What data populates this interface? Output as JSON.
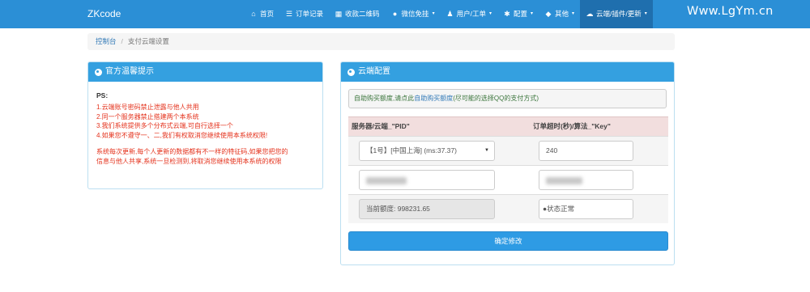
{
  "navbar": {
    "brand": "ZKcode",
    "items": [
      {
        "label": "首页",
        "icon": "home-icon",
        "glyph": "⌂",
        "caret": false,
        "active": false
      },
      {
        "label": "订单记录",
        "icon": "list-icon",
        "glyph": "☰",
        "caret": false,
        "active": false
      },
      {
        "label": "收款二维码",
        "icon": "qrcode-icon",
        "glyph": "▦",
        "caret": false,
        "active": false
      },
      {
        "label": "微信免挂",
        "icon": "wechat-icon",
        "glyph": "●",
        "caret": true,
        "active": false
      },
      {
        "label": "用户/工单",
        "icon": "user-icon",
        "glyph": "♟",
        "caret": true,
        "active": false
      },
      {
        "label": "配置",
        "icon": "gear-icon",
        "glyph": "✱",
        "caret": true,
        "active": false
      },
      {
        "label": "其他",
        "icon": "shield-icon",
        "glyph": "◆",
        "caret": true,
        "active": false
      },
      {
        "label": "云端/插件/更新",
        "icon": "cloud-icon",
        "glyph": "☁",
        "caret": true,
        "active": true
      }
    ],
    "caret_glyph": "▾",
    "watermark": "Www.LgYm.cn"
  },
  "breadcrumb": {
    "home": "控制台",
    "separator": "/",
    "current": "支付云端设置"
  },
  "left_panel": {
    "title": "官方温馨提示",
    "ps": "PS:",
    "lines": [
      "1.云端账号密码禁止泄露与他人共用",
      "2.同一个服务器禁止搭建两个本系统",
      "3.我们系统提供多个分布式云端,可自行选择一个",
      "4.如果您不遵守一、二,我们有权取消您继续使用本系统权限!"
    ],
    "warning_lines": [
      "系统每次更新,每个人更新的数据都有不一样的特征码,如果您把您的",
      "信息与他人共享,系统一旦检测到,将取消您继续使用本系统的权限"
    ]
  },
  "right_panel": {
    "title": "云端配置",
    "info_prefix": "自助购买额度,请点此",
    "info_link": "自助购买额度",
    "info_suffix": "(尽可能的选择QQ的支付方式)",
    "col_server": "服务器/云端_\"PID\"",
    "col_timeout": "订单超时(秒)/算法_\"Key\"",
    "server_select": "【1号】[中国上海] (ms:37.37)",
    "timeout_value": "240",
    "balance_label": "当前额度: 998231.65",
    "status_label": "状态正常",
    "submit_label": "确定修改"
  },
  "colors": {
    "navbar": "#2b8fd6",
    "panel_heading": "#34a0e0",
    "tip_red": "#e4311b",
    "info_green": "#3c763d",
    "table_header": "#f2dede"
  }
}
